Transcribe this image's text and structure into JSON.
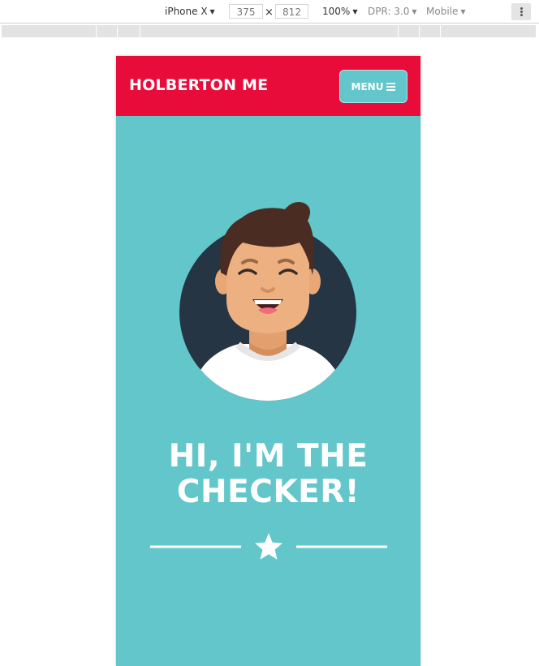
{
  "devtools": {
    "device": "iPhone X",
    "width": "375",
    "times": "×",
    "height": "812",
    "zoom": "100%",
    "dpr": "DPR: 3.0",
    "mode": "Mobile",
    "caret": "▼"
  },
  "header": {
    "brand": "HOLBERTON ME",
    "menu_label": "MENU",
    "menu_icon": "hamburger-icon"
  },
  "hero": {
    "avatar": "smiling-man-avatar",
    "line1": "HI, I'M THE",
    "line2": "CHECKER!",
    "divider_icon": "star-icon"
  },
  "colors": {
    "header_red": "#e80c3a",
    "teal": "#62c6ca",
    "avatar_bg": "#253544",
    "skin": "#edb081",
    "hair": "#4a2c22"
  }
}
